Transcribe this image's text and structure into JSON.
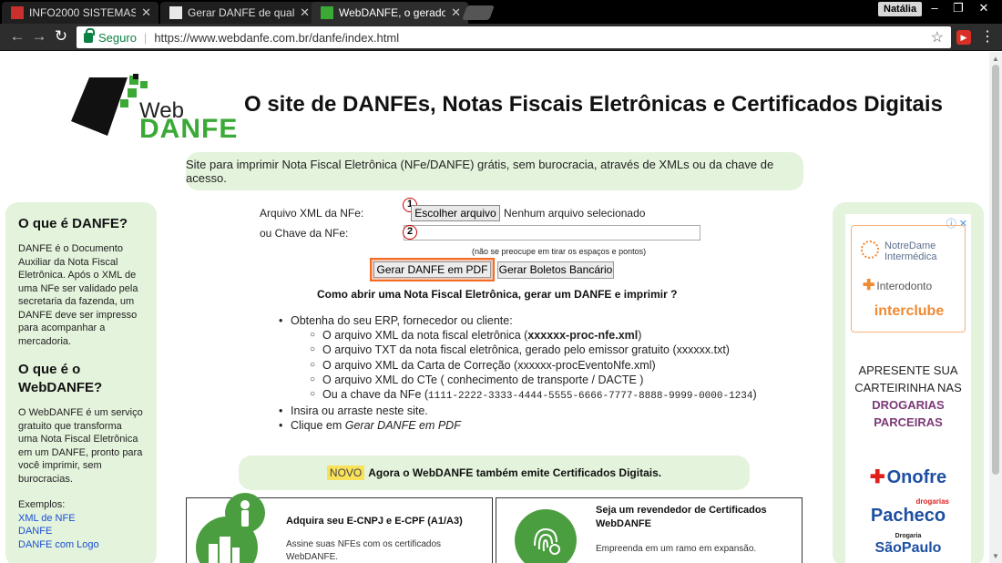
{
  "browser": {
    "tabs": [
      {
        "title": "INFO2000 SISTEMAS",
        "active": false,
        "fav_color": "#c9302c"
      },
      {
        "title": "Gerar DANFE de qualque",
        "active": false,
        "fav_color": "#e8e8e8"
      },
      {
        "title": "WebDANFE, o gerador gr",
        "active": true,
        "fav_color": "#3aa935"
      }
    ],
    "user": "Natália",
    "secure_label": "Seguro",
    "url": "https://www.webdanfe.com.br/danfe/index.html",
    "ext_label": "▶"
  },
  "logo": {
    "web": "Web",
    "danfe": "DANFE"
  },
  "site_title": "O site de DANFEs, Notas Fiscais Eletrônicas e Certificados Digitais",
  "tagline": "Site para imprimir Nota Fiscal Eletrônica (NFe/DANFE) grátis, sem burocracia, através de XMLs ou da chave de acesso.",
  "left_sidebar": {
    "h1": "O que é DANFE?",
    "p1": "DANFE é o Documento Auxiliar da Nota Fiscal Eletrônica. Após o XML de uma NFe ser validado pela secretaria da fazenda, um DANFE deve ser impresso para acompanhar a mercadoria.",
    "h2": "O que é o WebDANFE?",
    "p2": "O WebDANFE é um serviço gratuito que transforma uma Nota Fiscal Eletrônica em um DANFE, pronto para você imprimir, sem burocracias.",
    "examples_label": "Exemplos:",
    "links": [
      "XML de NFE",
      "DANFE",
      "DANFE com Logo"
    ]
  },
  "form": {
    "xml_label": "Arquivo XML da NFe:",
    "key_label": "ou Chave da NFe:",
    "marker1": "1",
    "marker2": "2",
    "file_button": "Escolher arquivo",
    "file_status": "Nenhum arquivo selecionado",
    "key_value": "",
    "hint": "(não se preocupe em tirar os espaços e pontos)",
    "pdf_button": "Gerar DANFE em PDF",
    "boletos_button": "Gerar Boletos Bancário",
    "howto": "Como abrir uma Nota Fiscal Eletrônica, gerar um DANFE e imprimir ?"
  },
  "steps": {
    "s1": "Obtenha do seu ERP, fornecedor ou cliente:",
    "s1a_pre": "O arquivo XML da nota fiscal eletrônica (",
    "s1a_bold": "xxxxxx-proc-nfe.xml",
    "s1a_post": ")",
    "s1b": "O arquivo TXT da nota fiscal eletrônica, gerado pelo emissor gratuito (xxxxxx.txt)",
    "s1c": "O arquivo XML da Carta de Correção (xxxxxx-procEventoNfe.xml)",
    "s1d": "O arquivo XML do CTe ( conhecimento de transporte / DACTE )",
    "s1e_pre": "Ou a chave da NFe (",
    "s1e_mono": "1111-2222-3333-4444-5555-6666-7777-8888-9999-0000-1234",
    "s1e_post": ")",
    "s2": "Insira ou arraste neste site.",
    "s3_pre": "Clique em ",
    "s3_em": "Gerar DANFE em PDF"
  },
  "novo": {
    "badge": "NOVO",
    "text": "Agora o WebDANFE também emite Certificados Digitais."
  },
  "cards": [
    {
      "title": "Adquira seu E-CNPJ e E-CPF (A1/A3)",
      "text": "Assine suas NFEs com os certificados WebDANFE."
    },
    {
      "title": "Seja um revendedor de Certificados WebDANFE",
      "text": "Empreenda em um ramo em expansão."
    }
  ],
  "ad": {
    "info": "ⓘ ✕",
    "notredame": "NotreDame Intermédica",
    "interodonto": "Interodonto",
    "interclube": "interclube",
    "msg1": "APRESENTE SUA CARTEIRINHA NAS",
    "msg2": "DROGARIAS PARCEIRAS",
    "onofre": "Onofre",
    "pacheco_small": "drogarias",
    "pacheco": "Pacheco",
    "sp_small": "Drogaria",
    "sp": "SãoPaulo"
  },
  "colors": {
    "accent_green": "#3aa935",
    "panel_green": "#e4f3dc",
    "highlight_orange": "#f46c24"
  }
}
